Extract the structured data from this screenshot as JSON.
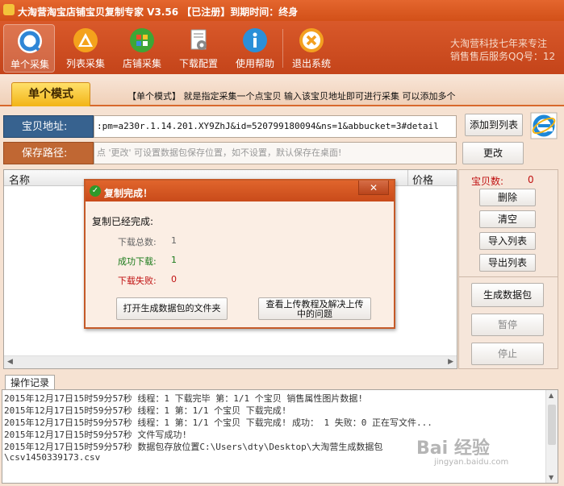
{
  "app": {
    "title": "大淘营淘宝店铺宝贝复制专家 V3.56 【已注册】到期时间：终身"
  },
  "toolbar": {
    "buttons": [
      {
        "label": "单个采集",
        "icon": "q-search-icon"
      },
      {
        "label": "列表采集",
        "icon": "list-triangle-icon"
      },
      {
        "label": "店铺采集",
        "icon": "store-grid-icon"
      },
      {
        "label": "下载配置",
        "icon": "config-gear-icon"
      },
      {
        "label": "使用帮助",
        "icon": "info-icon"
      },
      {
        "label": "退出系统",
        "icon": "exit-x-icon"
      }
    ],
    "info_line1": "大淘营科技七年来专注",
    "info_line2": "销售售后服务QQ号：12"
  },
  "mode": {
    "tab_label": "单个模式",
    "description": "【单个模式】 就是指定采集一个点宝贝  输入该宝贝地址即可进行采集  可以添加多个"
  },
  "url": {
    "label": "宝贝地址:",
    "value": ":pm=a230r.1.14.201.XY9ZhJ&id=520799180094&ns=1&abbucket=3#detail",
    "add_button": "添加到列表"
  },
  "path": {
    "label": "保存路径:",
    "placeholder": "点 '更改' 可设置数据包保存位置，如不设置，默认保存在桌面!",
    "change_button": "更改"
  },
  "table": {
    "columns": [
      "名称",
      "价格"
    ]
  },
  "side": {
    "count_label": "宝贝数:",
    "count_value": "0",
    "buttons": [
      "删除",
      "清空",
      "导入列表",
      "导出列表"
    ],
    "generate_button": "生成数据包",
    "pause_button": "暂停",
    "stop_button": "停止"
  },
  "dialog": {
    "title": "复制完成！",
    "close_label": "✕",
    "message": "复制已经完成:",
    "stats": [
      {
        "label": "下载总数:",
        "value": "1"
      },
      {
        "label": "成功下载:",
        "value": "1"
      },
      {
        "label": "下载失败:",
        "value": "0"
      }
    ],
    "open_button": "打开生成数据包的文件夹",
    "tutorial_button_line1": "查看上传教程及解决上传",
    "tutorial_button_line2": "中的问题"
  },
  "log": {
    "tab_label": "操作记录",
    "lines": [
      "2015年12月17日15时59分57秒 线程：1  下载完毕 第：1/1  个宝贝   销售属性图片数据!",
      "2015年12月17日15时59分57秒 线程：1 第：1/1 个宝贝 下载完成!",
      "2015年12月17日15时59分57秒  线程：1 第：1/1 个宝贝 下载完成! 成功： 1 失败：0 正在写文件...",
      "2015年12月17日15时59分57秒 文件写成功!",
      "2015年12月17日15时59分57秒 数据包存放位置C:\\Users\\dty\\Desktop\\大淘营生成数据包",
      "\\csv1450339173.csv"
    ]
  },
  "watermark": {
    "text": "Bai 经验",
    "sub": "jingyan.baidu.com"
  },
  "colors": {
    "title_bar": "#d25018",
    "toolbar": "#c4441a",
    "mode_tab": "#f2b416",
    "url_label_bg": "#37628f",
    "path_label_bg": "#c06733",
    "success_green": "#1a7a1a",
    "fail_red": "#c01010"
  }
}
